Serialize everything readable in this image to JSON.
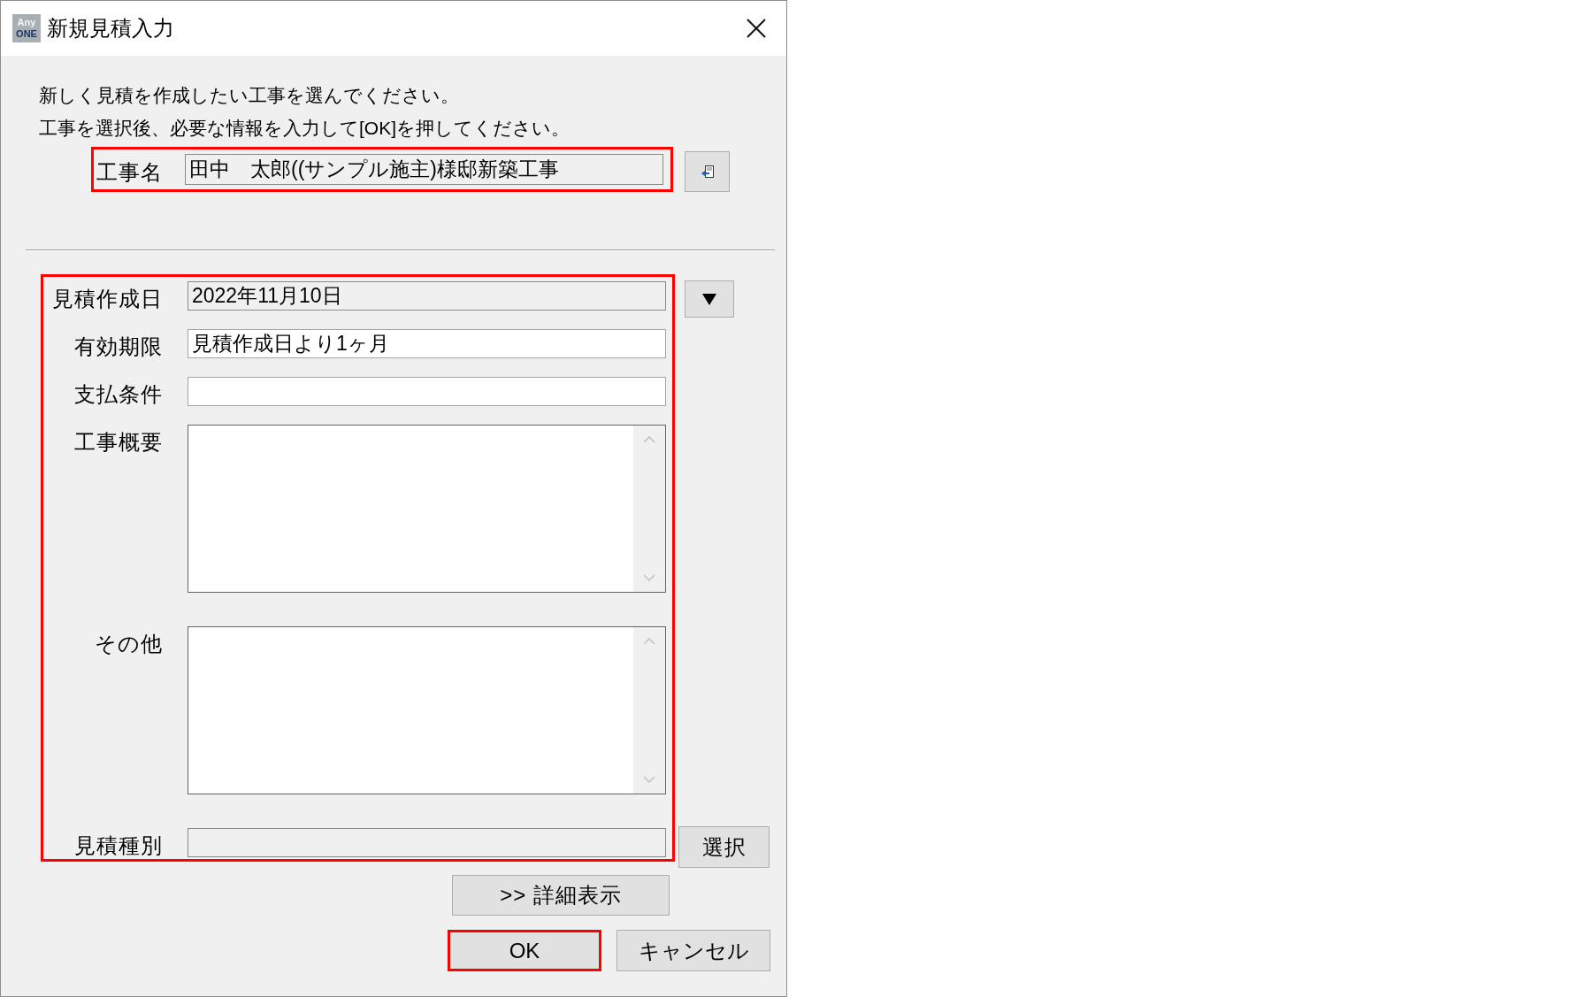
{
  "window": {
    "title": "新規見積入力",
    "logo": [
      "Any",
      "ONE"
    ]
  },
  "instructions": [
    "新しく見積を作成したい工事を選んでください。",
    "工事を選択後、必要な情報を入力して[OK]を押してください。"
  ],
  "project": {
    "label": "工事名",
    "value": "田中　太郎((サンプル施主)様邸新築工事",
    "readonly": true,
    "highlighted": true
  },
  "form": {
    "highlighted": true,
    "fields": [
      {
        "kind": "date",
        "label": "見積作成日",
        "value": "2022年11月10日",
        "readonly": true
      },
      {
        "kind": "text",
        "label": "有効期限",
        "value": "見積作成日より1ヶ月",
        "readonly": false
      },
      {
        "kind": "text",
        "label": "支払条件",
        "readonly": false
      },
      {
        "kind": "textarea",
        "label": "工事概要",
        "readonly": false
      },
      {
        "kind": "textarea",
        "label": "その他",
        "readonly": false
      },
      {
        "kind": "picker",
        "label": "見積種別",
        "readonly": true,
        "button": "選択"
      }
    ]
  },
  "details_button": {
    "label": ">> 詳細表示"
  },
  "buttons": [
    {
      "label": "OK",
      "highlighted": true
    },
    {
      "label": "キャンセル",
      "highlighted": false
    }
  ]
}
